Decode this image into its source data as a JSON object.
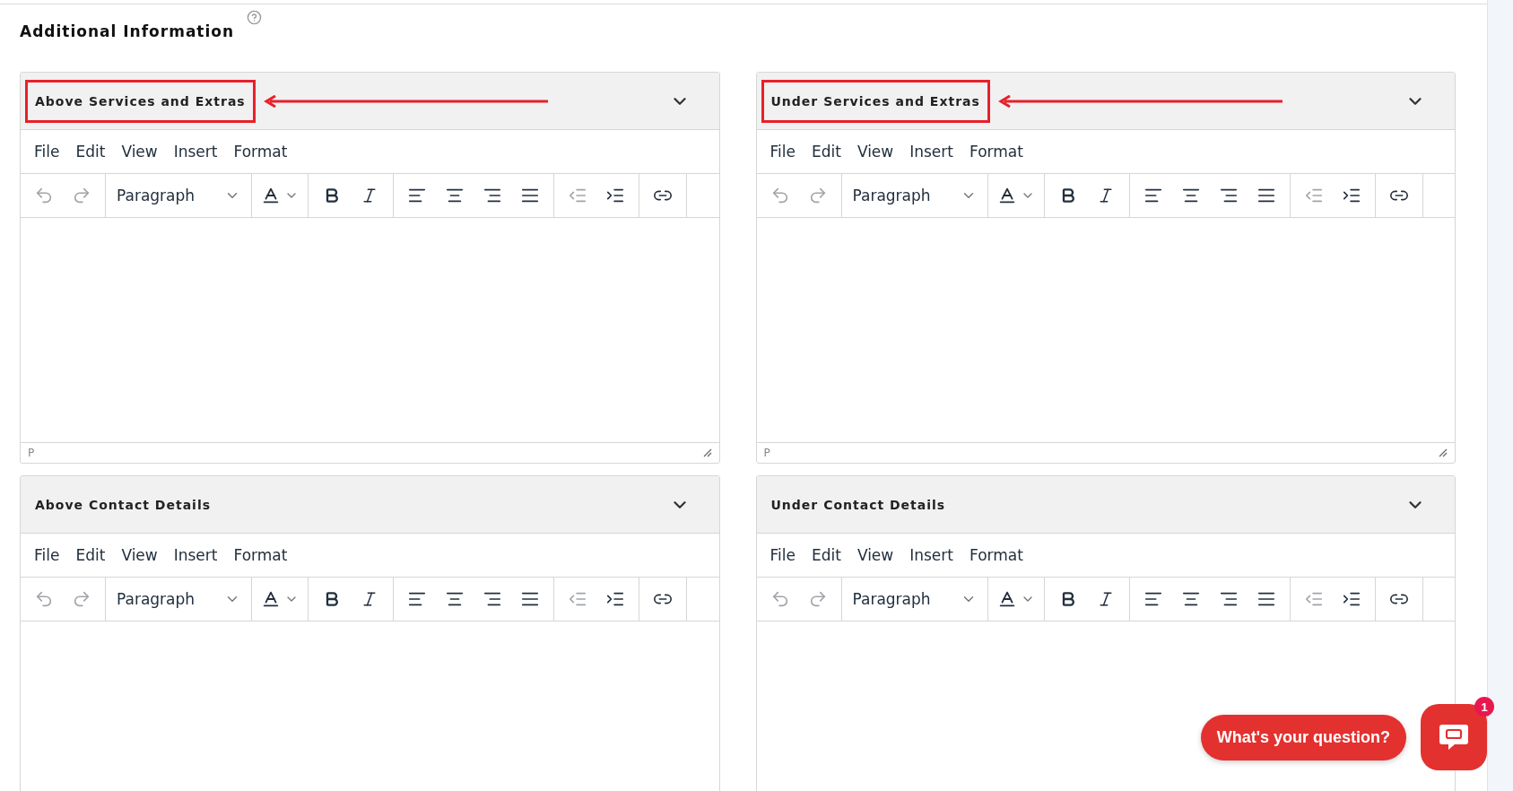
{
  "page_title": "Additional Information",
  "editors": [
    {
      "title": "Above Services and Extras",
      "highlighted": true,
      "expanded": true,
      "menu": [
        "File",
        "Edit",
        "View",
        "Insert",
        "Format"
      ],
      "block_format": "Paragraph",
      "status_path": "P"
    },
    {
      "title": "Under Services and Extras",
      "highlighted": true,
      "expanded": true,
      "menu": [
        "File",
        "Edit",
        "View",
        "Insert",
        "Format"
      ],
      "block_format": "Paragraph",
      "status_path": "P"
    },
    {
      "title": "Above Contact Details",
      "highlighted": false,
      "expanded": true,
      "menu": [
        "File",
        "Edit",
        "View",
        "Insert",
        "Format"
      ],
      "block_format": "Paragraph"
    },
    {
      "title": "Under Contact Details",
      "highlighted": false,
      "expanded": true,
      "menu": [
        "File",
        "Edit",
        "View",
        "Insert",
        "Format"
      ],
      "block_format": "Paragraph"
    }
  ],
  "toolbar": [
    {
      "kind": "undo",
      "disabled": true
    },
    {
      "kind": "redo",
      "disabled": true
    },
    {
      "kind": "format"
    },
    {
      "kind": "color"
    },
    {
      "kind": "bold",
      "disabled": false
    },
    {
      "kind": "italic",
      "disabled": false
    },
    {
      "kind": "align-left",
      "disabled": false
    },
    {
      "kind": "align-center",
      "disabled": false
    },
    {
      "kind": "align-right",
      "disabled": false
    },
    {
      "kind": "justify",
      "disabled": false
    },
    {
      "kind": "outdent",
      "disabled": true
    },
    {
      "kind": "indent",
      "disabled": false
    },
    {
      "kind": "link",
      "disabled": false
    }
  ],
  "chat": {
    "prompt": "What's your question?",
    "badge": "1"
  }
}
